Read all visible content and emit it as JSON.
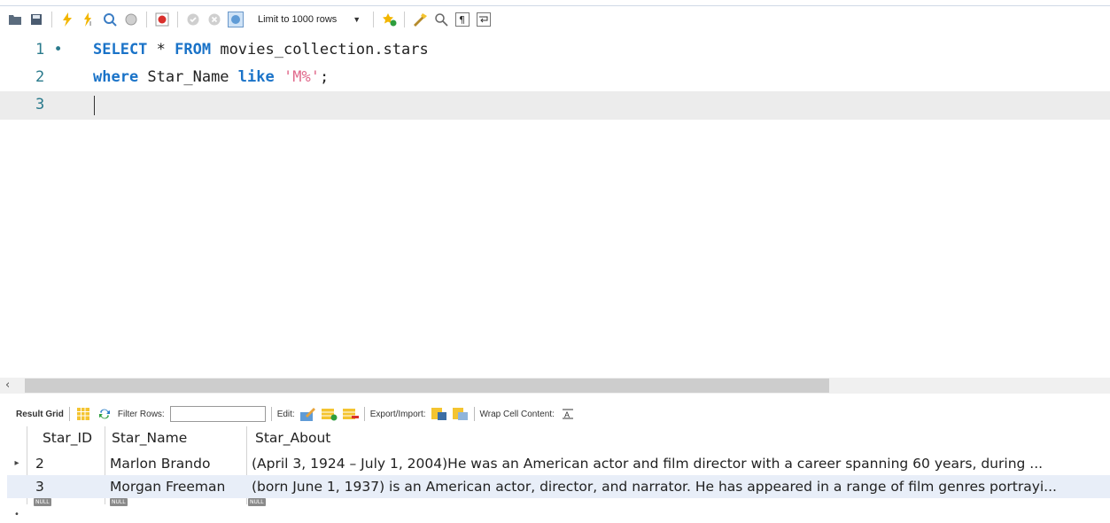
{
  "toolbar": {
    "icons": [
      "folder-open-icon",
      "save-icon",
      "execute-lightning-icon",
      "execute-current-icon",
      "explain-magnifier-icon",
      "stop-icon",
      "toggle-error-icon",
      "commit-icon",
      "rollback-icon",
      "autocommit-icon",
      "beautify-icon",
      "find-icon",
      "invisible-chars-icon",
      "wrap-icon",
      "add-snippet-icon"
    ],
    "limit_select": "Limit to 1000 rows"
  },
  "editor": {
    "lines": [
      {
        "number": "1 •",
        "tokens": [
          {
            "t": "SELECT",
            "k": "kw"
          },
          {
            "t": " * ",
            "k": ""
          },
          {
            "t": "FROM",
            "k": "kw"
          },
          {
            "t": " movies_collection.stars",
            "k": ""
          }
        ]
      },
      {
        "number": "2",
        "tokens": [
          {
            "t": "where",
            "k": "kw"
          },
          {
            "t": " Star_Name ",
            "k": ""
          },
          {
            "t": "like",
            "k": "kw"
          },
          {
            "t": " ",
            "k": ""
          },
          {
            "t": "'M%'",
            "k": "str"
          },
          {
            "t": ";",
            "k": ""
          }
        ]
      },
      {
        "number": "3",
        "tokens": []
      }
    ]
  },
  "scrollbar": {
    "left_arrow": "‹"
  },
  "result_toolbar": {
    "result_grid": "Result Grid",
    "filter_rows": "Filter Rows:",
    "edit": "Edit:",
    "export_import": "Export/Import:",
    "wrap_cell_content": "Wrap Cell Content:"
  },
  "grid": {
    "columns": [
      "Star_ID",
      "Star_Name",
      "Star_About"
    ],
    "rows": [
      [
        "2",
        "Marlon Brando",
        "(April 3, 1924 – July 1, 2004)He was an American actor and film director with a career spanning 60 years,  during ..."
      ],
      [
        "3",
        "Morgan Freeman",
        "(born June 1, 1937) is an American actor, director, and narrator. He has appeared in a range of film genres portrayi..."
      ]
    ],
    "null_label": "NULL",
    "current_marker": "▸",
    "new_marker": "•"
  },
  "colors": {
    "keyword": "#1a73c8",
    "string": "#e06a8c",
    "gutter": "#2a7a8c",
    "alt_row": "#e8eef8"
  }
}
